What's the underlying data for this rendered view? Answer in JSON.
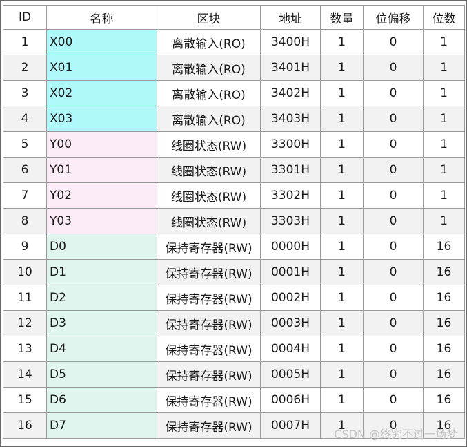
{
  "table": {
    "headers": [
      "ID",
      "名称",
      "区块",
      "地址",
      "数量",
      "位偏移",
      "位数"
    ],
    "rows": [
      {
        "id": "1",
        "name": "X00",
        "group": "x",
        "block": "离散输入(RO)",
        "addr": "3400H",
        "qty": "1",
        "offset": "0",
        "bits": "1"
      },
      {
        "id": "2",
        "name": "X01",
        "group": "x",
        "block": "离散输入(RO)",
        "addr": "3401H",
        "qty": "1",
        "offset": "0",
        "bits": "1"
      },
      {
        "id": "3",
        "name": "X02",
        "group": "x",
        "block": "离散输入(RO)",
        "addr": "3402H",
        "qty": "1",
        "offset": "0",
        "bits": "1"
      },
      {
        "id": "4",
        "name": "X03",
        "group": "x",
        "block": "离散输入(RO)",
        "addr": "3403H",
        "qty": "1",
        "offset": "0",
        "bits": "1"
      },
      {
        "id": "5",
        "name": "Y00",
        "group": "y",
        "block": "线圈状态(RW)",
        "addr": "3300H",
        "qty": "1",
        "offset": "0",
        "bits": "1"
      },
      {
        "id": "6",
        "name": "Y01",
        "group": "y",
        "block": "线圈状态(RW)",
        "addr": "3301H",
        "qty": "1",
        "offset": "0",
        "bits": "1"
      },
      {
        "id": "7",
        "name": "Y02",
        "group": "y",
        "block": "线圈状态(RW)",
        "addr": "3302H",
        "qty": "1",
        "offset": "0",
        "bits": "1"
      },
      {
        "id": "8",
        "name": "Y03",
        "group": "y",
        "block": "线圈状态(RW)",
        "addr": "3303H",
        "qty": "1",
        "offset": "0",
        "bits": "1"
      },
      {
        "id": "9",
        "name": "D0",
        "group": "d",
        "block": "保持寄存器(RW)",
        "addr": "0000H",
        "qty": "1",
        "offset": "0",
        "bits": "16"
      },
      {
        "id": "10",
        "name": "D1",
        "group": "d",
        "block": "保持寄存器(RW)",
        "addr": "0001H",
        "qty": "1",
        "offset": "0",
        "bits": "16"
      },
      {
        "id": "11",
        "name": "D2",
        "group": "d",
        "block": "保持寄存器(RW)",
        "addr": "0002H",
        "qty": "1",
        "offset": "0",
        "bits": "16"
      },
      {
        "id": "12",
        "name": "D3",
        "group": "d",
        "block": "保持寄存器(RW)",
        "addr": "0003H",
        "qty": "1",
        "offset": "0",
        "bits": "16"
      },
      {
        "id": "13",
        "name": "D4",
        "group": "d",
        "block": "保持寄存器(RW)",
        "addr": "0004H",
        "qty": "1",
        "offset": "0",
        "bits": "16"
      },
      {
        "id": "14",
        "name": "D5",
        "group": "d",
        "block": "保持寄存器(RW)",
        "addr": "0005H",
        "qty": "1",
        "offset": "0",
        "bits": "16"
      },
      {
        "id": "15",
        "name": "D6",
        "group": "d",
        "block": "保持寄存器(RW)",
        "addr": "0006H",
        "qty": "1",
        "offset": "0",
        "bits": "16"
      },
      {
        "id": "16",
        "name": "D7",
        "group": "d",
        "block": "保持寄存器(RW)",
        "addr": "0007H",
        "qty": "1",
        "offset": "0",
        "bits": "16"
      }
    ]
  },
  "colors": {
    "x_group": "#aff9fb",
    "y_group": "#fcecf7",
    "d_group": "#dff5ee"
  },
  "watermark": "CSDN @终究不过一场梦"
}
